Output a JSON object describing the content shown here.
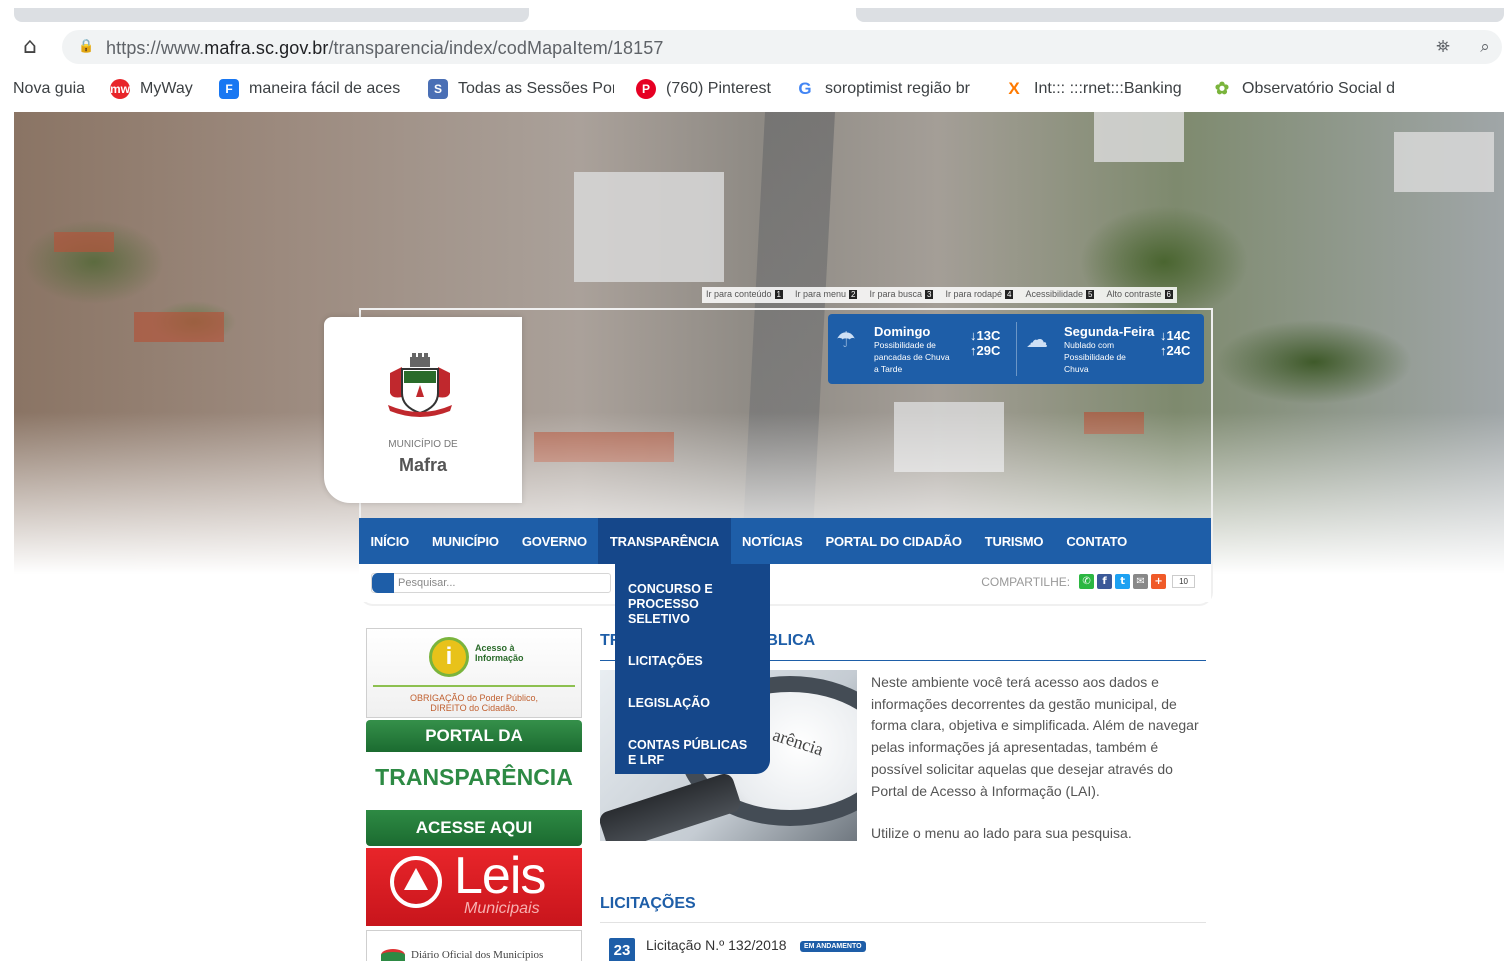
{
  "browser": {
    "url_prefix": "https://www.",
    "url_domain": "mafra.sc.gov.br",
    "url_path": "/transparencia/index/codMapaItem/18157",
    "bookmarks": [
      {
        "label": "Nova guia",
        "icon": "none"
      },
      {
        "label": "MyWay",
        "icon": "myway-icon",
        "glyph": "mw",
        "color": "#e8252a"
      },
      {
        "label": "maneira fácil de aces",
        "icon": "facebook-icon",
        "glyph": "F",
        "color": "#1877f2"
      },
      {
        "label": "Todas as Sessões Por",
        "icon": "sessions-icon",
        "glyph": "S",
        "color": "#4a6fb5"
      },
      {
        "label": "(760) Pinterest",
        "icon": "pinterest-icon",
        "glyph": "P",
        "color": "#e60023"
      },
      {
        "label": "soroptimist região br",
        "icon": "google-icon",
        "glyph": "G",
        "color": "#4285f4"
      },
      {
        "label": "Int::: :::rnet:::Banking",
        "icon": "banking-icon",
        "glyph": "X",
        "color": "#ff7a00"
      },
      {
        "label": "Observatório Social d",
        "icon": "observatorio-icon",
        "glyph": "✿",
        "color": "#7ab43c"
      }
    ]
  },
  "accessibility": {
    "items": [
      {
        "label": "Ir para conteúdo",
        "key": "1"
      },
      {
        "label": "Ir para menu",
        "key": "2"
      },
      {
        "label": "Ir para busca",
        "key": "3"
      },
      {
        "label": "Ir para rodapé",
        "key": "4"
      },
      {
        "label": "Acessibilidade",
        "key": "5"
      },
      {
        "label": "Alto contraste",
        "key": "6"
      }
    ]
  },
  "logo": {
    "sub": "MUNICÍPIO DE",
    "name": "Mafra"
  },
  "weather": {
    "days": [
      {
        "day": "Domingo",
        "desc": "Possibilidade de pancadas de Chuva a Tarde",
        "min": "13C",
        "max": "29C"
      },
      {
        "day": "Segunda-Feira",
        "desc": "Nublado com Possibilidade de Chuva",
        "min": "14C",
        "max": "24C"
      }
    ]
  },
  "nav": {
    "items": [
      "INÍCIO",
      "MUNICÍPIO",
      "GOVERNO",
      "TRANSPARÊNCIA",
      "NOTÍCIAS",
      "PORTAL DO CIDADÃO",
      "TURISMO",
      "CONTATO"
    ],
    "active_index": 3
  },
  "toolbar": {
    "search_placeholder": "Pesquisar...",
    "share_label": "COMPARTILHE:",
    "share_count": "10"
  },
  "dropdown": {
    "items": [
      "CONCURSO E PROCESSO SELETIVO",
      "LICITAÇÕES",
      "LEGISLAÇÃO",
      "CONTAS PÚBLICAS E LRF"
    ]
  },
  "sidebar": {
    "acesso_title": "Acesso à Informação",
    "acesso_line1": "OBRIGAÇÃO do Poder Público,",
    "acesso_line2": "DIREITO do Cidadão.",
    "transp_top": "PORTAL DA",
    "transp_mid": "TRANSPARÊNCIA",
    "transp_bot": "ACESSE AQUI",
    "leis_title": "Leis",
    "leis_sub": "Municipais",
    "diario": "Diário Oficial dos Municípios"
  },
  "main": {
    "section_title_left": "TR",
    "section_title_right": "BLICA",
    "lens_text": "arência",
    "intro": "Neste ambiente você terá acesso aos dados e informações decorrentes da gestão municipal, de forma clara, objetiva e simplificada. Além de navegar pelas informações já apresentadas, também é possível solicitar aquelas que desejar através do Portal de Acesso à Informação (LAI).",
    "intro2": "Utilize o menu ao lado para sua pesquisa.",
    "licitacoes_title": "LICITAÇÕES",
    "licitacao": {
      "day": "23",
      "title": "Licitação N.º 132/2018",
      "badge": "EM ANDAMENTO"
    }
  }
}
